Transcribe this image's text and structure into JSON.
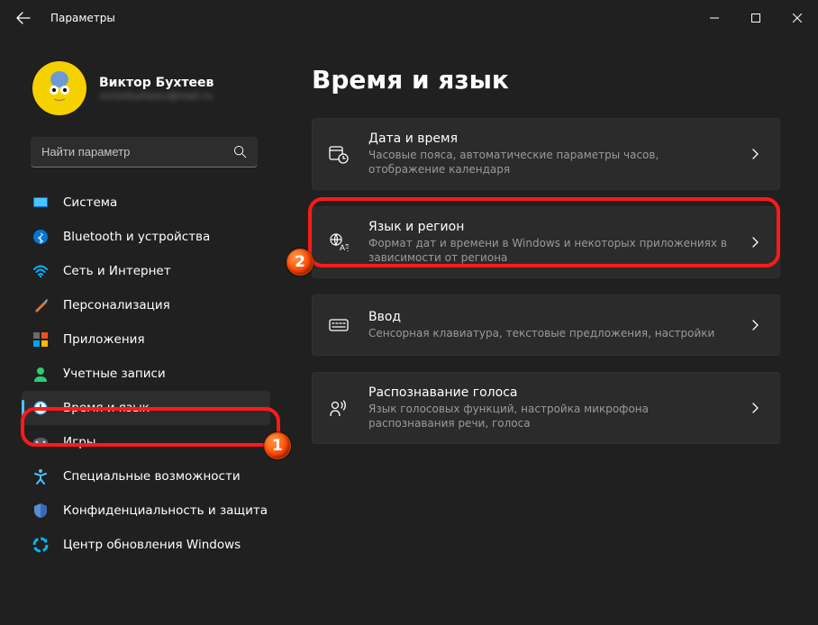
{
  "titlebar": {
    "title": "Параметры"
  },
  "user": {
    "name": "Виктор Бухтеев",
    "sub": "victorbuhteev@mail.ru"
  },
  "search": {
    "placeholder": "Найти параметр"
  },
  "sidebar": {
    "items": [
      {
        "label": "Система"
      },
      {
        "label": "Bluetooth и устройства"
      },
      {
        "label": "Сеть и Интернет"
      },
      {
        "label": "Персонализация"
      },
      {
        "label": "Приложения"
      },
      {
        "label": "Учетные записи"
      },
      {
        "label": "Время и язык"
      },
      {
        "label": "Игры"
      },
      {
        "label": "Специальные возможности"
      },
      {
        "label": "Конфиденциальность и защита"
      },
      {
        "label": "Центр обновления Windows"
      }
    ]
  },
  "main": {
    "heading": "Время и язык",
    "cards": [
      {
        "title": "Дата и время",
        "desc": "Часовые пояса, автоматические параметры часов, отображение календаря"
      },
      {
        "title": "Язык и регион",
        "desc": "Формат дат и времени в Windows и некоторых приложениях в зависимости от региона"
      },
      {
        "title": "Ввод",
        "desc": "Сенсорная клавиатура, текстовые предложения, настройки"
      },
      {
        "title": "Распознавание голоса",
        "desc": "Язык голосовых функций, настройка микрофона распознавания речи, голоса"
      }
    ]
  },
  "annotations": {
    "badge1": "1",
    "badge2": "2"
  }
}
